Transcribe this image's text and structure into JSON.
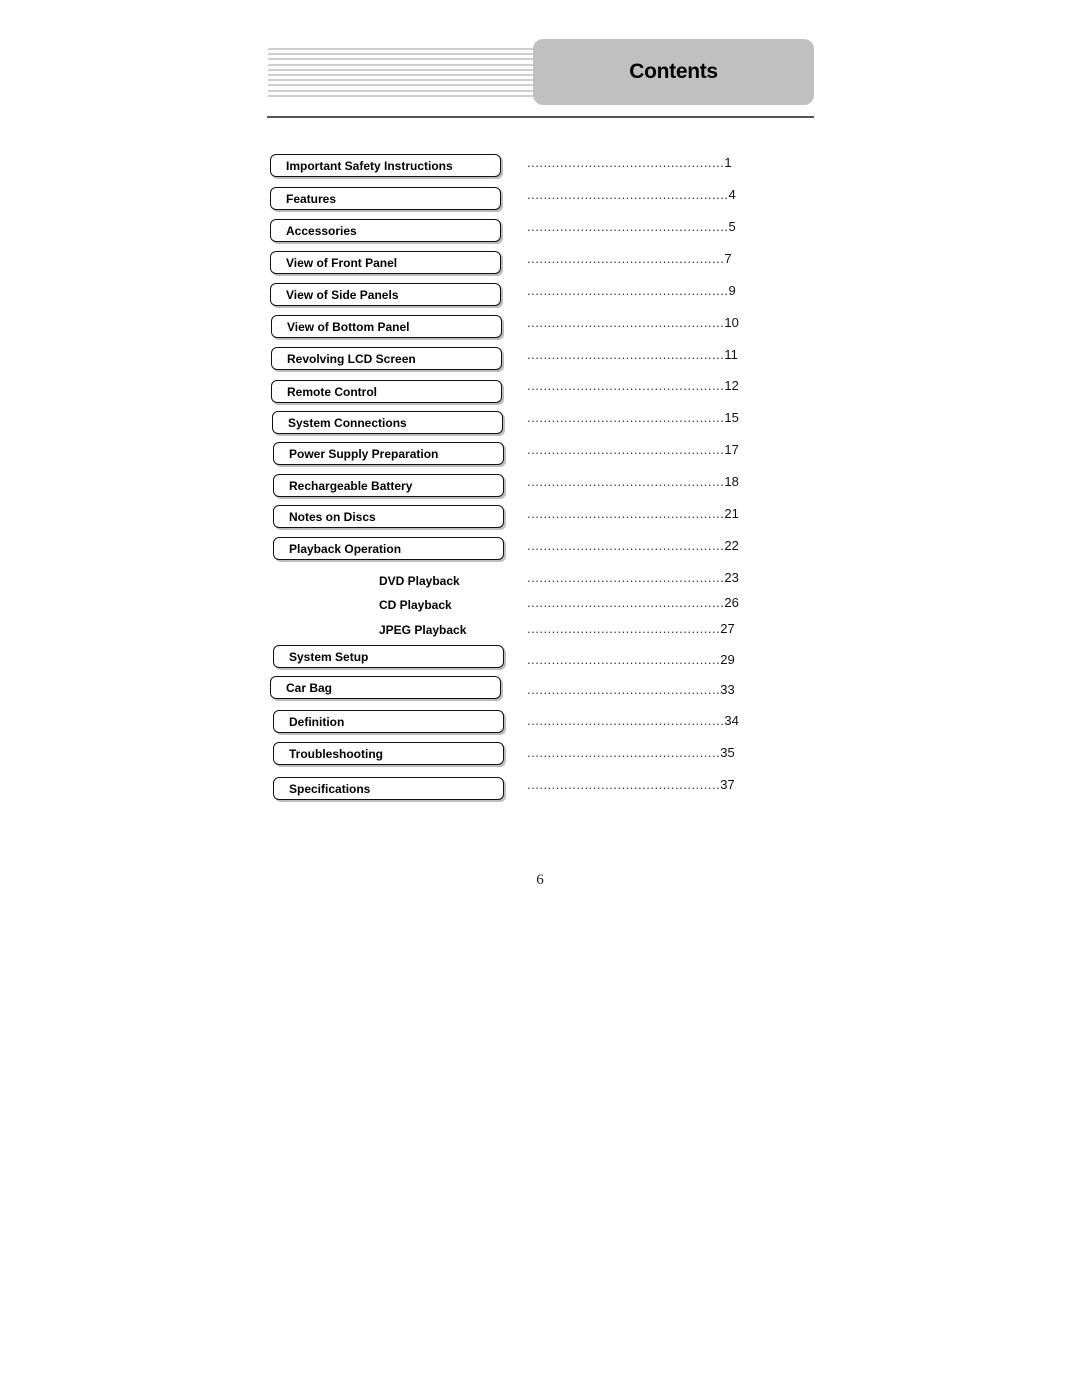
{
  "header": {
    "title": "Contents"
  },
  "toc": [
    {
      "label": "Important Safety Instructions",
      "page": "1",
      "type": "box"
    },
    {
      "label": "Features",
      "page": "4",
      "type": "box"
    },
    {
      "label": "Accessories",
      "page": "5",
      "type": "box"
    },
    {
      "label": "View of Front Panel",
      "page": "7",
      "type": "box"
    },
    {
      "label": "View of Side Panels",
      "page": "9",
      "type": "box"
    },
    {
      "label": "View of Bottom Panel",
      "page": "10",
      "type": "box"
    },
    {
      "label": "Revolving LCD Screen",
      "page": "11",
      "type": "box"
    },
    {
      "label": "Remote Control",
      "page": "12",
      "type": "box"
    },
    {
      "label": "System Connections",
      "page": "15",
      "type": "box"
    },
    {
      "label": "Power Supply Preparation",
      "page": "17",
      "type": "box"
    },
    {
      "label": "Rechargeable Battery",
      "page": "18",
      "type": "box"
    },
    {
      "label": "Notes on Discs",
      "page": "21",
      "type": "box"
    },
    {
      "label": "Playback Operation",
      "page": "22",
      "type": "box"
    },
    {
      "label": "DVD Playback",
      "page": "23",
      "type": "sub"
    },
    {
      "label": "CD Playback",
      "page": "26",
      "type": "sub"
    },
    {
      "label": "JPEG Playback",
      "page": "27",
      "type": "sub"
    },
    {
      "label": "System Setup",
      "page": "29",
      "type": "box"
    },
    {
      "label": "Car Bag",
      "page": "33",
      "type": "box"
    },
    {
      "label": "Definition",
      "page": "34",
      "type": "box"
    },
    {
      "label": "Troubleshooting",
      "page": "35",
      "type": "box"
    },
    {
      "label": "Specifications",
      "page": "37",
      "type": "box"
    }
  ],
  "footer": {
    "page_number": "6"
  }
}
